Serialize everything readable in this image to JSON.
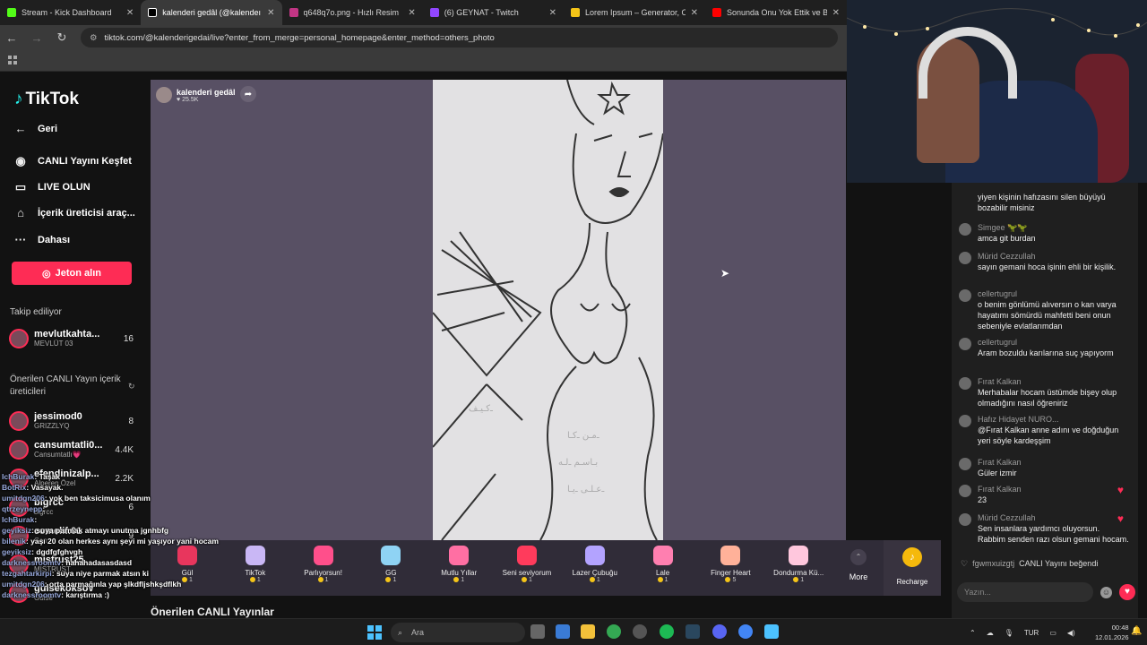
{
  "browser": {
    "tabs": [
      {
        "label": "Stream - Kick Dashboard",
        "color": "#53fc18",
        "active": false
      },
      {
        "label": "kalenderi gedâl (@kalendeı",
        "color": "#000000",
        "active": true
      },
      {
        "label": "q648q7o.png - Hızlı Resim",
        "color": "#c13584",
        "active": false
      },
      {
        "label": "(6) GEYNAT - Twitch",
        "color": "#9146ff",
        "active": false
      },
      {
        "label": "Lorem Ipsum – Generator, Orig",
        "color": "#f5c518",
        "active": false
      },
      {
        "label": "Sonunda Onu Yok Ettik ve BÜY",
        "color": "#ff0000",
        "active": false
      }
    ],
    "url": "tiktok.com/@kalenderigedai/live?enter_from_merge=personal_homepage&enter_method=others_photo"
  },
  "sidebar": {
    "logo": "TikTok",
    "nav": [
      {
        "icon": "back-arrow-icon",
        "glyph": "←",
        "label": "Geri"
      },
      {
        "icon": "live-explore-icon",
        "glyph": "◉",
        "label": "CANLI Yayını Keşfet"
      },
      {
        "icon": "camera-icon",
        "glyph": "▭",
        "label": "LIVE OLUN"
      },
      {
        "icon": "creator-tools-icon",
        "glyph": "⌂",
        "label": "İçerik üreticisi araç..."
      },
      {
        "icon": "more-dots-icon",
        "glyph": "···",
        "label": "Dahası"
      }
    ],
    "coin_button": "Jeton alın",
    "following_title": "Takip ediliyor",
    "following": [
      {
        "name": "mevlutkahta...",
        "sub": "MEVLÜT 03",
        "count": "16"
      }
    ],
    "suggested_title": "Önerilen CANLI Yayın içerik üreticileri",
    "suggested": [
      {
        "name": "jessimod0",
        "sub": "GRIZZLYQ",
        "count": "8"
      },
      {
        "name": "cansumtatli0...",
        "sub": "Cansumtatlı💗",
        "count": "4.4K"
      },
      {
        "name": "efendinizalp...",
        "sub": "Alperen Özel",
        "count": "2.2K"
      },
      {
        "name": "blgrcc",
        "sub": "blgrcc",
        "count": "6"
      },
      {
        "name": "cemelif.01",
        "sub": "Can",
        "count": "9"
      },
      {
        "name": "mistrust25",
        "sub": "MISTRUST",
        "count": ""
      },
      {
        "name": "gulsekoksov",
        "sub": "Gülse",
        "count": ""
      }
    ]
  },
  "stream": {
    "host_name": "kalenderi gedâl",
    "host_likes": "♥ 25.5K",
    "bottom_title": "Önerilen CANLI Yayınlar"
  },
  "gifts": [
    {
      "name": "Gül",
      "price": "1",
      "color": "#e8365d"
    },
    {
      "name": "TikTok",
      "price": "1",
      "color": "#c9b7f5"
    },
    {
      "name": "Parlıyorsun!",
      "price": "1",
      "color": "#ff4f8b"
    },
    {
      "name": "GG",
      "price": "1",
      "color": "#8fd3f4"
    },
    {
      "name": "Mutlu Yıllar",
      "price": "1",
      "color": "#ff6fa3"
    },
    {
      "name": "Seni seviyorum",
      "price": "1",
      "color": "#ff3b5c"
    },
    {
      "name": "Lazer Çubuğu",
      "price": "1",
      "color": "#b3a3ff"
    },
    {
      "name": "Lale",
      "price": "1",
      "color": "#ff7fb0"
    },
    {
      "name": "Finger Heart",
      "price": "5",
      "color": "#ffb199"
    },
    {
      "name": "Dondurma Kü...",
      "price": "1",
      "color": "#ffc7dd"
    }
  ],
  "gift_more": "More",
  "recharge": "Recharge",
  "chat": {
    "messages": [
      {
        "name": "",
        "text": "yiyen kişinin hafızasını silen büyüyü bozabilir misiniz",
        "heart": false
      },
      {
        "name": "Simgee 🦖🦖",
        "text": "amca git burdan",
        "heart": false
      },
      {
        "name": "Mürid Cezzullah",
        "text": "sayın gemani hoca işinin ehli bir kişilik.",
        "heart": false
      },
      {
        "name": "cellertugrul",
        "text": "o benim gönlümü alıversın o kan varya hayatımı sömürdü mahfetti beni onun sebeniyle evlatlarımdan",
        "heart": false
      },
      {
        "name": "cellertugrul",
        "text": "Aram bozuldu karılarına suç yapıyorm",
        "heart": false
      },
      {
        "name": "Fırat Kalkan",
        "text": "Merhabalar hocam üstümde bişey olup olmadığını nasıl öğreniriz",
        "heart": false
      },
      {
        "name": "Hafız Hidayet NURO...",
        "text": "@Fırat Kalkan anne adını ve doğduğun yeri söyle kardeşşim",
        "heart": false
      },
      {
        "name": "Fırat Kalkan",
        "text": "Güler izmir",
        "heart": false
      },
      {
        "name": "Fırat Kalkan",
        "text": "23",
        "heart": true
      },
      {
        "name": "Mürid Cezzullah",
        "text": "Sen insanlara yardımcı oluyorsun. Rabbim senden razı olsun gemani hocam.",
        "heart": true
      }
    ],
    "like_user": "fgwmxuizgtj",
    "like_text": "CANLI Yayını beğendi",
    "input_placeholder": "Yazın..."
  },
  "overlay_chat": [
    {
      "name": "IchBurak",
      "text": ": Taşak"
    },
    {
      "name": "BotRix",
      "text": ": Vasayak."
    },
    {
      "name": "umitdgn206",
      "text": ": yok ben taksicimusa olanım"
    },
    {
      "name": "qtrzeynepp",
      "text": ":"
    },
    {
      "name": "IchBurak",
      "text": ":"
    },
    {
      "name": "geyiksiz",
      "text": ": suya parmak atmayı unutma jgnhbfg"
    },
    {
      "name": "bilenik",
      "text": ": yaşı 20 olan herkes aynı şeyi mi yaşıyor yani hocam"
    },
    {
      "name": "geyiksiz",
      "text": ": dgdfgfghvgh"
    },
    {
      "name": "darknessroomtv",
      "text": ": hahahadasasdasd"
    },
    {
      "name": "tezgahtarkirpi",
      "text": ": suya niye parmak atsın ki"
    },
    {
      "name": "umitdgn206",
      "text": ": orta parmağınla yap şlkdfljshkşdflkh"
    },
    {
      "name": "darknessroomtv",
      "text": ": karıştırma :)"
    }
  ],
  "taskbar": {
    "search_placeholder": "Ara",
    "language": "TUR",
    "time": "00:48",
    "date": "12.01.2026"
  }
}
